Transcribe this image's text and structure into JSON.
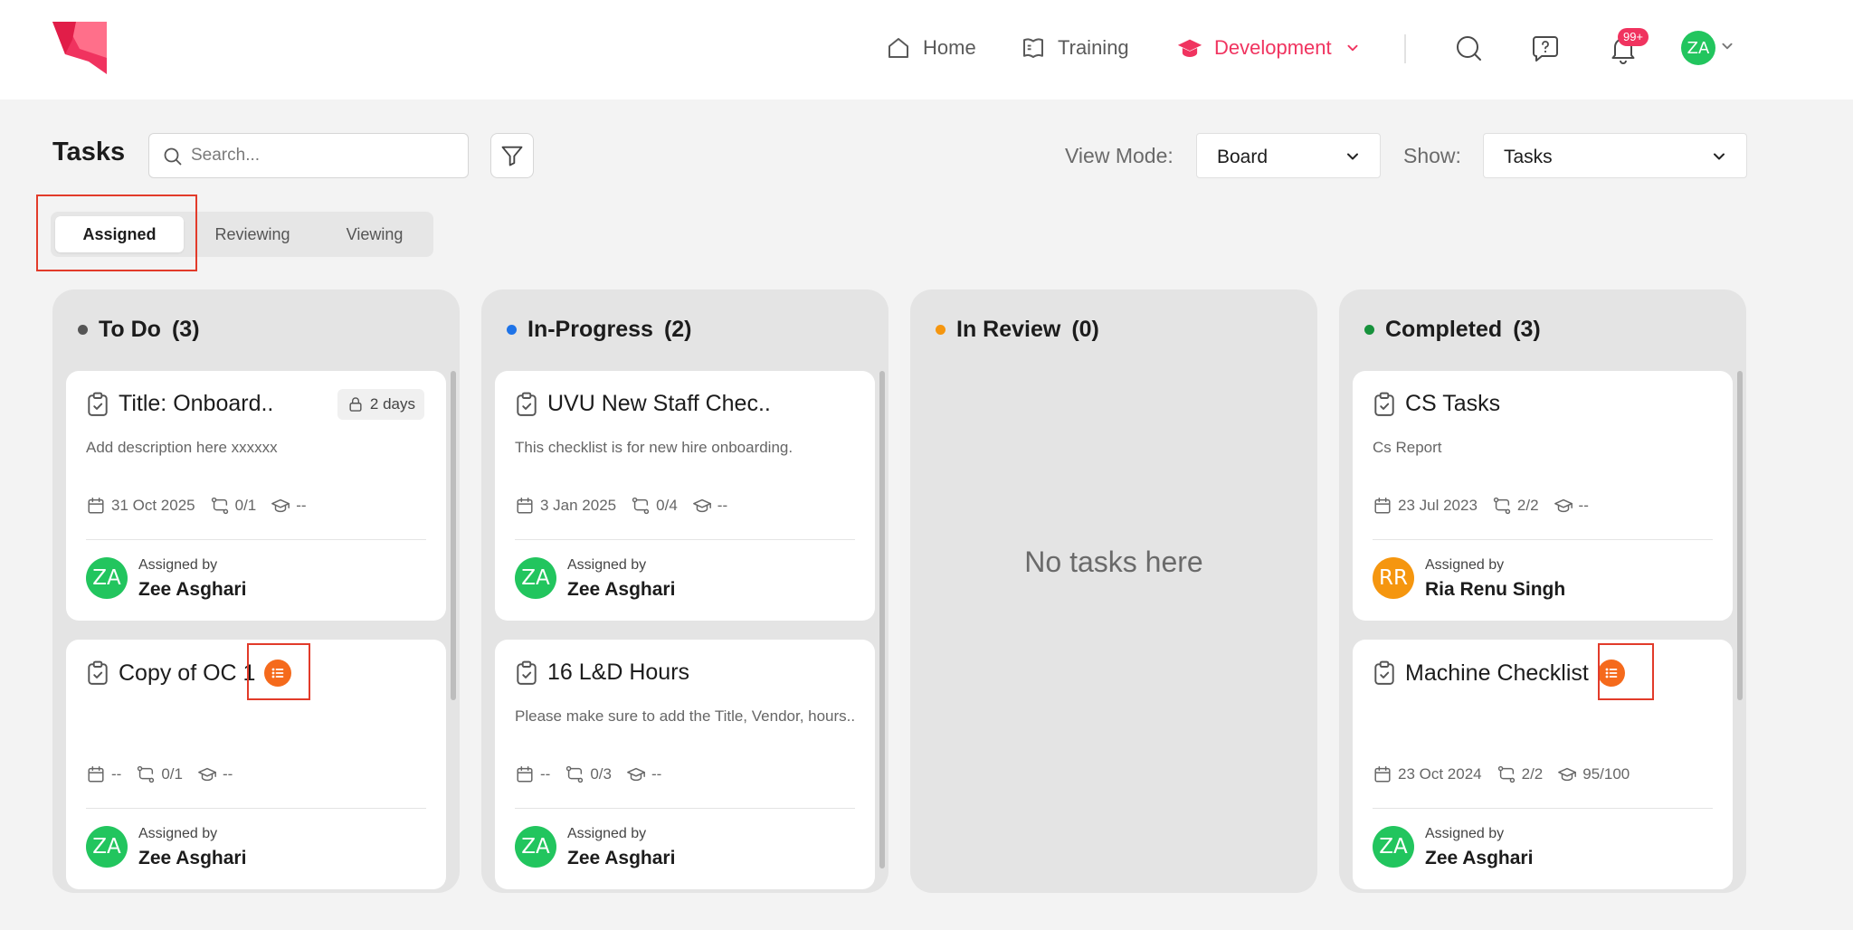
{
  "nav": {
    "home": "Home",
    "training": "Training",
    "development": "Development",
    "notifications_badge": "99+",
    "user_initials": "ZA"
  },
  "toolbar": {
    "title": "Tasks",
    "search_placeholder": "Search...",
    "view_mode_label": "View Mode:",
    "view_mode_value": "Board",
    "show_label": "Show:",
    "show_value": "Tasks"
  },
  "tabs": [
    "Assigned",
    "Reviewing",
    "Viewing"
  ],
  "active_tab": "Assigned",
  "colors": {
    "accent": "#f0335f",
    "todo": "#555555",
    "in_progress": "#1e73e8",
    "in_review": "#f5960f",
    "completed": "#17923c",
    "avatar_green": "#22c55e",
    "avatar_orange": "#f5960f",
    "checklist_orange": "#f56a1c"
  },
  "columns": [
    {
      "title": "To Do",
      "count": "(3)",
      "cards": [
        {
          "title": "Title: Onboard..",
          "badge": "2 days",
          "description": "Add description here xxxxxx",
          "date": "31 Oct 2025",
          "steps": "0/1",
          "score": "--",
          "assigned_by_label": "Assigned by",
          "assigned_by": "Zee Asghari",
          "initials": "ZA"
        },
        {
          "title": "Copy of OC 1",
          "description": "",
          "date": "--",
          "steps": "0/1",
          "score": "--",
          "assigned_by_label": "Assigned by",
          "assigned_by": "Zee Asghari",
          "initials": "ZA"
        }
      ]
    },
    {
      "title": "In-Progress",
      "count": "(2)",
      "cards": [
        {
          "title": "UVU New Staff Chec..",
          "description": "This checklist is for new hire onboarding.",
          "date": "3 Jan 2025",
          "steps": "0/4",
          "score": "--",
          "assigned_by_label": "Assigned by",
          "assigned_by": "Zee Asghari",
          "initials": "ZA"
        },
        {
          "title": "16 L&D Hours",
          "description": "Please make sure to add the Title, Vendor, hours..",
          "date": "--",
          "steps": "0/3",
          "score": "--",
          "assigned_by_label": "Assigned by",
          "assigned_by": "Zee Asghari",
          "initials": "ZA"
        }
      ]
    },
    {
      "title": "In Review",
      "count": "(0)",
      "empty_text": "No tasks here"
    },
    {
      "title": "Completed",
      "count": "(3)",
      "cards": [
        {
          "title": "CS Tasks",
          "description": "Cs Report",
          "date": "23 Jul 2023",
          "steps": "2/2",
          "score": "--",
          "assigned_by_label": "Assigned by",
          "assigned_by": "Ria Renu Singh",
          "initials": "RR"
        },
        {
          "title": "Machine Checklist",
          "description": "",
          "date": "23 Oct 2024",
          "steps": "2/2",
          "score": "95/100",
          "assigned_by_label": "Assigned by",
          "assigned_by": "Zee Asghari",
          "initials": "ZA"
        }
      ]
    }
  ]
}
